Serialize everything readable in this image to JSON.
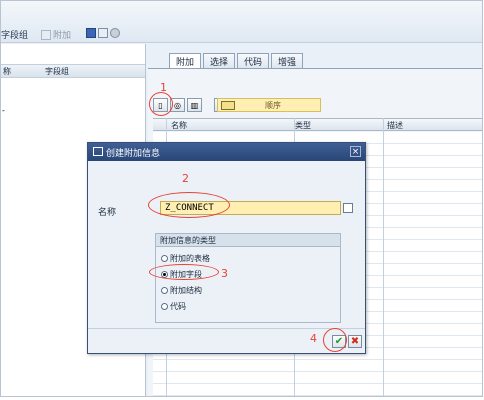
{
  "toolbar": {
    "field_group_label": "字段组",
    "append_label": "附加"
  },
  "left_panel": {
    "col1": "称",
    "col2": "字段组",
    "row_text": "-"
  },
  "tabs": [
    {
      "label": "附加"
    },
    {
      "label": "选择"
    },
    {
      "label": "代码"
    },
    {
      "label": "增强"
    }
  ],
  "sequence_label": "顺序",
  "grid": {
    "col_name": "名称",
    "col_type": "类型",
    "col_desc": "描述"
  },
  "dialog": {
    "title": "创建附加信息",
    "close_glyph": "×",
    "name_label": "名称",
    "name_value": "Z_CONNECT",
    "type_group_title": "附加信息的类型",
    "options": [
      {
        "label": "附加的表格",
        "selected": false
      },
      {
        "label": "附加字段",
        "selected": true
      },
      {
        "label": "附加结构",
        "selected": false
      },
      {
        "label": "代码",
        "selected": false
      }
    ],
    "ok_glyph": "✔",
    "cancel_glyph": "✖"
  },
  "annotations": {
    "n1": "1",
    "n2": "2",
    "n3": "3",
    "n4": "4"
  },
  "colors": {
    "annotation": "#e84335",
    "title_bar": "#2f4f84",
    "input_highlight": "#ffefb3"
  },
  "icons": [
    "new-document-icon",
    "find-icon",
    "delete-icon",
    "table-icon",
    "sequence-icon",
    "check-icon",
    "cancel-icon",
    "f4-help-icon"
  ]
}
